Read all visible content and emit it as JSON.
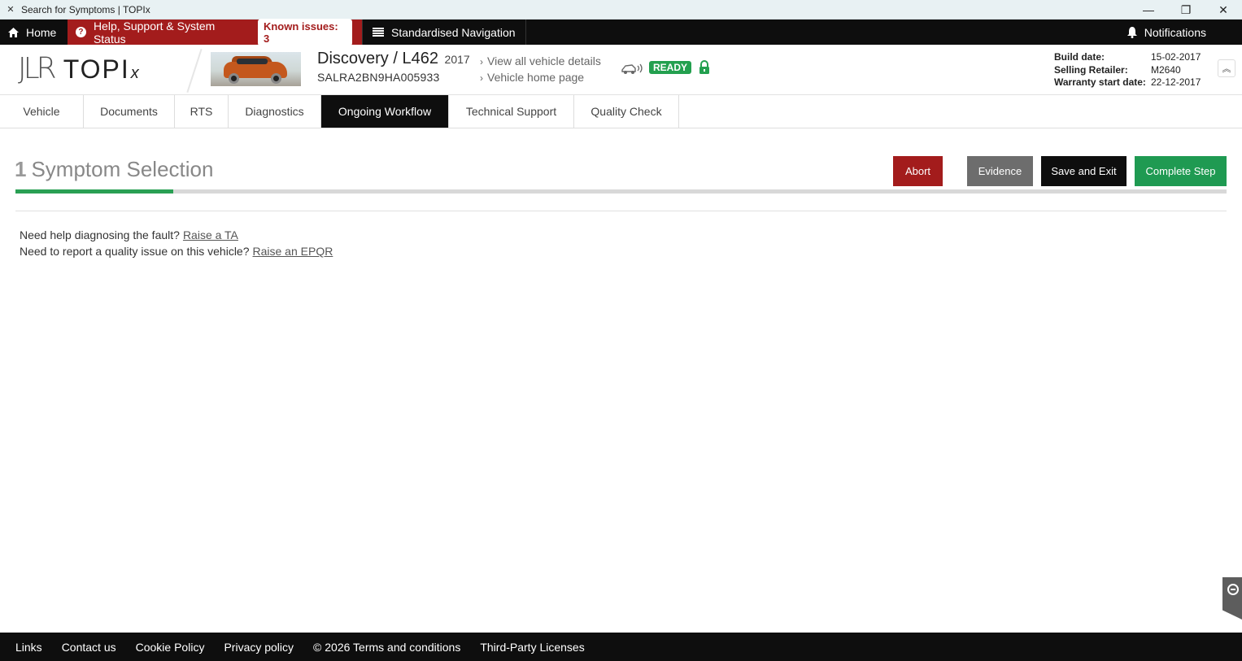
{
  "window": {
    "title": "Search for Symptoms | TOPIx",
    "minimize": "—",
    "maximize": "❐",
    "close": "✕"
  },
  "topnav": {
    "home": "Home",
    "help": "Help, Support & System Status",
    "known_issues": "Known issues: 3",
    "standardised_navigation": "Standardised Navigation",
    "notifications": "Notifications"
  },
  "logo": {
    "jlr": "JLR",
    "topix": "TOPI",
    "x": "x"
  },
  "vehicle": {
    "model": "Discovery / L462",
    "year": "2017",
    "vin": "SALRA2BN9HA005933",
    "view_all_details": "View all vehicle details",
    "home_page": "Vehicle home page",
    "status": "READY",
    "build_date_label": "Build date:",
    "build_date": "15-02-2017",
    "selling_retailer_label": "Selling Retailer:",
    "selling_retailer": "M2640",
    "warranty_label": "Warranty start date:",
    "warranty_date": "22-12-2017"
  },
  "tabs": [
    {
      "label": "Vehicle"
    },
    {
      "label": "Documents"
    },
    {
      "label": "RTS"
    },
    {
      "label": "Diagnostics"
    },
    {
      "label": "Ongoing Workflow"
    },
    {
      "label": "Technical Support"
    },
    {
      "label": "Quality Check"
    }
  ],
  "active_tab": "Ongoing Workflow",
  "step": {
    "number": "1",
    "title": "Symptom Selection",
    "progress_fraction": 0.13
  },
  "actions": {
    "abort": "Abort",
    "evidence": "Evidence",
    "save_exit": "Save and Exit",
    "complete": "Complete Step"
  },
  "help": {
    "ta_text": "Need help diagnosing the fault?",
    "ta_link": "Raise a TA",
    "epqr_text": "Need to report a quality issue on this vehicle?",
    "epqr_link": "Raise an EPQR"
  },
  "footer": [
    {
      "label": "Links"
    },
    {
      "label": "Contact us"
    },
    {
      "label": "Cookie Policy"
    },
    {
      "label": "Privacy policy"
    },
    {
      "label": "© 2026 Terms and conditions"
    },
    {
      "label": "Third-Party Licenses"
    }
  ],
  "colors": {
    "brand_red": "#a31c1c",
    "brand_green": "#1f9a52",
    "dark": "#0e0e0e"
  }
}
